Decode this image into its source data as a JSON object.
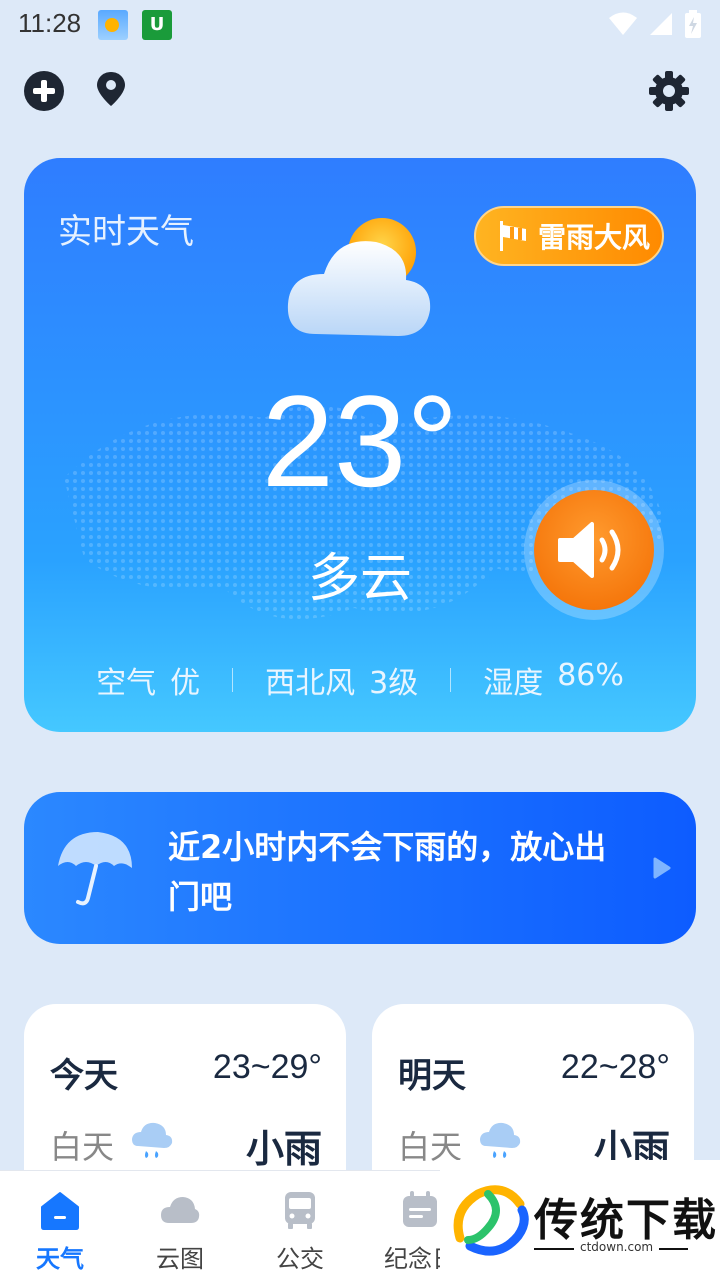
{
  "status_bar": {
    "time": "11:28",
    "ime_label": "U"
  },
  "hero": {
    "title": "实时天气",
    "alert_label": "雷雨大风",
    "temperature": "23°",
    "condition": "多云",
    "air_label": "空气",
    "air_value": "优",
    "wind_label": "西北风",
    "wind_value": "3级",
    "humidity_label": "湿度",
    "humidity_value": "86%"
  },
  "rain_banner": {
    "text": "近2小时内不会下雨的，放心出门吧"
  },
  "days": [
    {
      "name": "今天",
      "range": "23~29°",
      "period": "白天",
      "condition": "小雨"
    },
    {
      "name": "明天",
      "range": "22~28°",
      "period": "白天",
      "condition": "小雨"
    }
  ],
  "nav": [
    {
      "label": "天气",
      "icon": "house-icon",
      "active": true
    },
    {
      "label": "云图",
      "icon": "cloud-icon"
    },
    {
      "label": "公交",
      "icon": "bus-icon"
    },
    {
      "label": "纪念日",
      "icon": "calendar-icon"
    }
  ],
  "watermark": {
    "brand": "传统下载",
    "url": "ctdown.com"
  },
  "colors": {
    "accent": "#1677ff",
    "card_blue": "#2f7dff",
    "alert_orange": "#ff8a00"
  }
}
